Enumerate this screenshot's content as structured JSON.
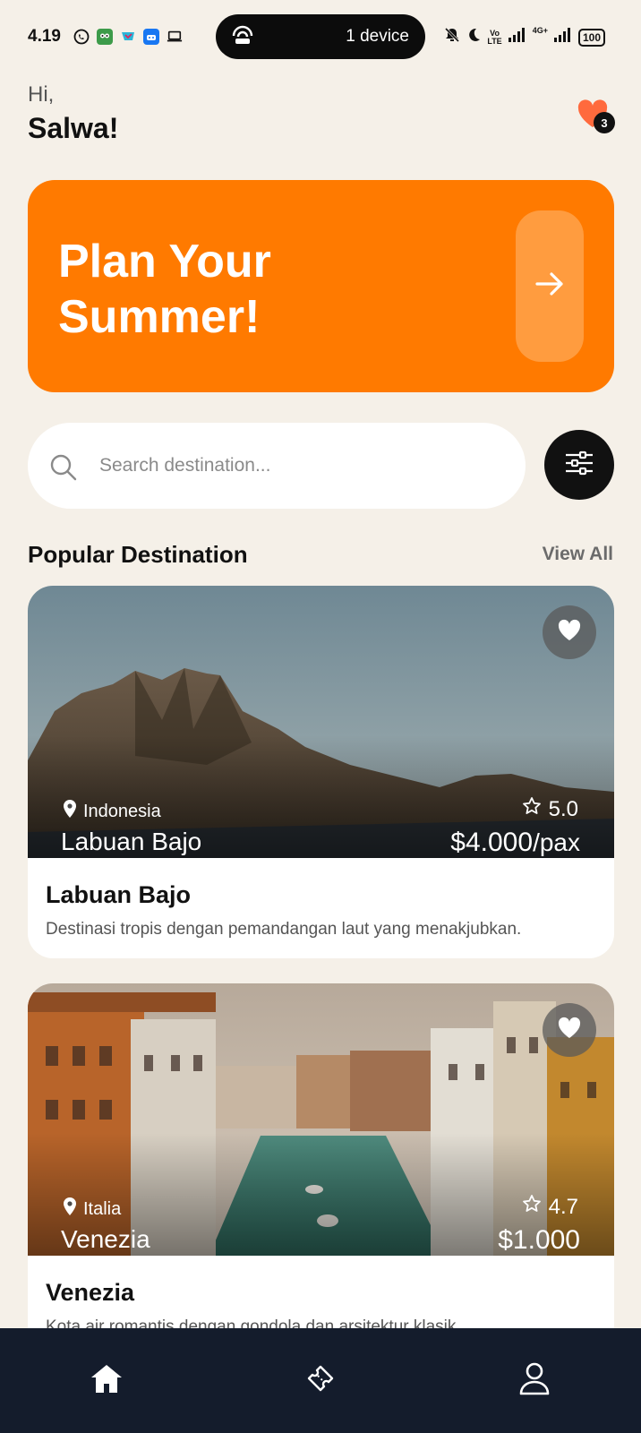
{
  "status_bar": {
    "time": "4.19",
    "pill_text": "1 device",
    "network_label_top": "Vo",
    "network_label_bottom": "LTE",
    "network_type": "4G+",
    "battery": "100"
  },
  "header": {
    "greeting": "Hi,",
    "username": "Salwa!",
    "favorites_count": "3"
  },
  "banner": {
    "title": "Plan Your Summer!"
  },
  "search": {
    "placeholder": "Search destination..."
  },
  "section": {
    "title": "Popular Destination",
    "view_all": "View All"
  },
  "destinations": [
    {
      "country": "Indonesia",
      "name": "Labuan Bajo",
      "rating": "5.0",
      "price": "$4.000",
      "price_unit": "/pax",
      "title": "Labuan Bajo",
      "description": "Destinasi tropis dengan pemandangan laut yang menakjubkan."
    },
    {
      "country": "Italia",
      "name": "Venezia",
      "rating": "4.7",
      "price": "$1.000",
      "price_unit": "",
      "title": "Venezia",
      "description": "Kota air romantis dengan gondola dan arsitektur klasik."
    }
  ],
  "bottom_nav": {
    "items": [
      "home-icon",
      "ticket-icon",
      "profile-icon"
    ]
  },
  "colors": {
    "accent": "#ff7a00",
    "background": "#f5f0e8",
    "nav_background": "#141c2c"
  }
}
